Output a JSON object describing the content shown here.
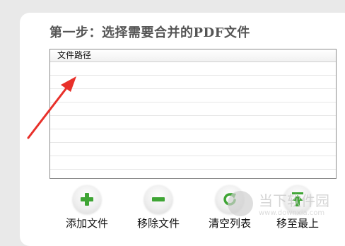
{
  "step": {
    "title": "第一步：选择需要合并的PDF文件"
  },
  "file_list": {
    "column_header": "文件路径",
    "rows": []
  },
  "toolbar": {
    "buttons": [
      {
        "label": "添加文件",
        "icon": "plus-icon",
        "color": "#3fa535"
      },
      {
        "label": "移除文件",
        "icon": "minus-icon",
        "color": "#3fa535"
      },
      {
        "label": "清空列表",
        "icon": "refresh-icon",
        "color": "#3fa535"
      },
      {
        "label": "移至最上",
        "icon": "arrow-up-icon",
        "color": "#3fa535"
      }
    ]
  },
  "watermark": {
    "text": "当下软件园",
    "url": "www.downxia.com"
  },
  "annotation": {
    "arrow_color": "#e8302a"
  }
}
